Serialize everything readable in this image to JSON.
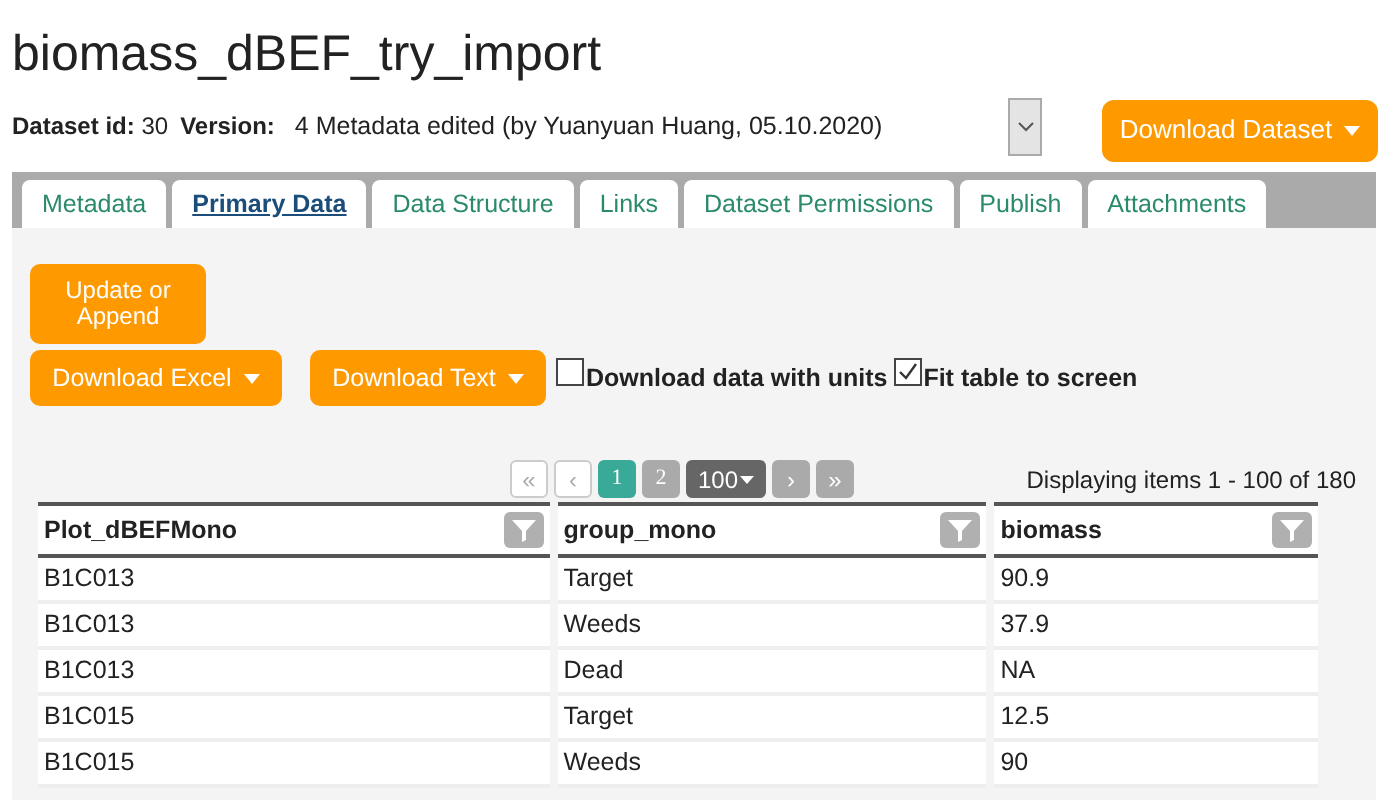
{
  "title": "biomass_dBEF_try_import",
  "info": {
    "id_label": "Dataset id:",
    "id_value": "30",
    "version_label": "Version:",
    "version_value": "4 Metadata edited (by Yuanyuan Huang, 05.10.2020)"
  },
  "download_dataset": "Download Dataset",
  "tabs": [
    {
      "label": "Metadata",
      "selected": false
    },
    {
      "label": "Primary Data",
      "selected": true
    },
    {
      "label": "Data Structure",
      "selected": false
    },
    {
      "label": "Links",
      "selected": false
    },
    {
      "label": "Dataset Permissions",
      "selected": false
    },
    {
      "label": "Publish",
      "selected": false
    },
    {
      "label": "Attachments",
      "selected": false
    }
  ],
  "update_button": "Update or Append",
  "download_buttons": [
    "Download Excel",
    "Download Text"
  ],
  "options": [
    {
      "label": "Download data with units",
      "checked": false
    },
    {
      "label": "Fit table to screen",
      "checked": true
    }
  ],
  "pager": [
    {
      "label": "«",
      "kind": "nav",
      "disabled": true
    },
    {
      "label": "‹",
      "kind": "nav",
      "disabled": true
    },
    {
      "label": "1",
      "kind": "page",
      "selected": true
    },
    {
      "label": "2",
      "kind": "page",
      "selected": false
    },
    {
      "label": "100",
      "kind": "size"
    },
    {
      "label": "›",
      "kind": "arrow"
    },
    {
      "label": "»",
      "kind": "arrow"
    }
  ],
  "items_info": "Displaying items 1 - 100 of 180",
  "table": {
    "columns": [
      "Plot_dBEFMono",
      "group_mono",
      "biomass"
    ],
    "rows": [
      [
        "B1C013",
        "Target",
        "90.9"
      ],
      [
        "B1C013",
        "Weeds",
        "37.9"
      ],
      [
        "B1C013",
        "Dead",
        "NA"
      ],
      [
        "B1C015",
        "Target",
        "12.5"
      ],
      [
        "B1C015",
        "Weeds",
        "90"
      ]
    ]
  }
}
